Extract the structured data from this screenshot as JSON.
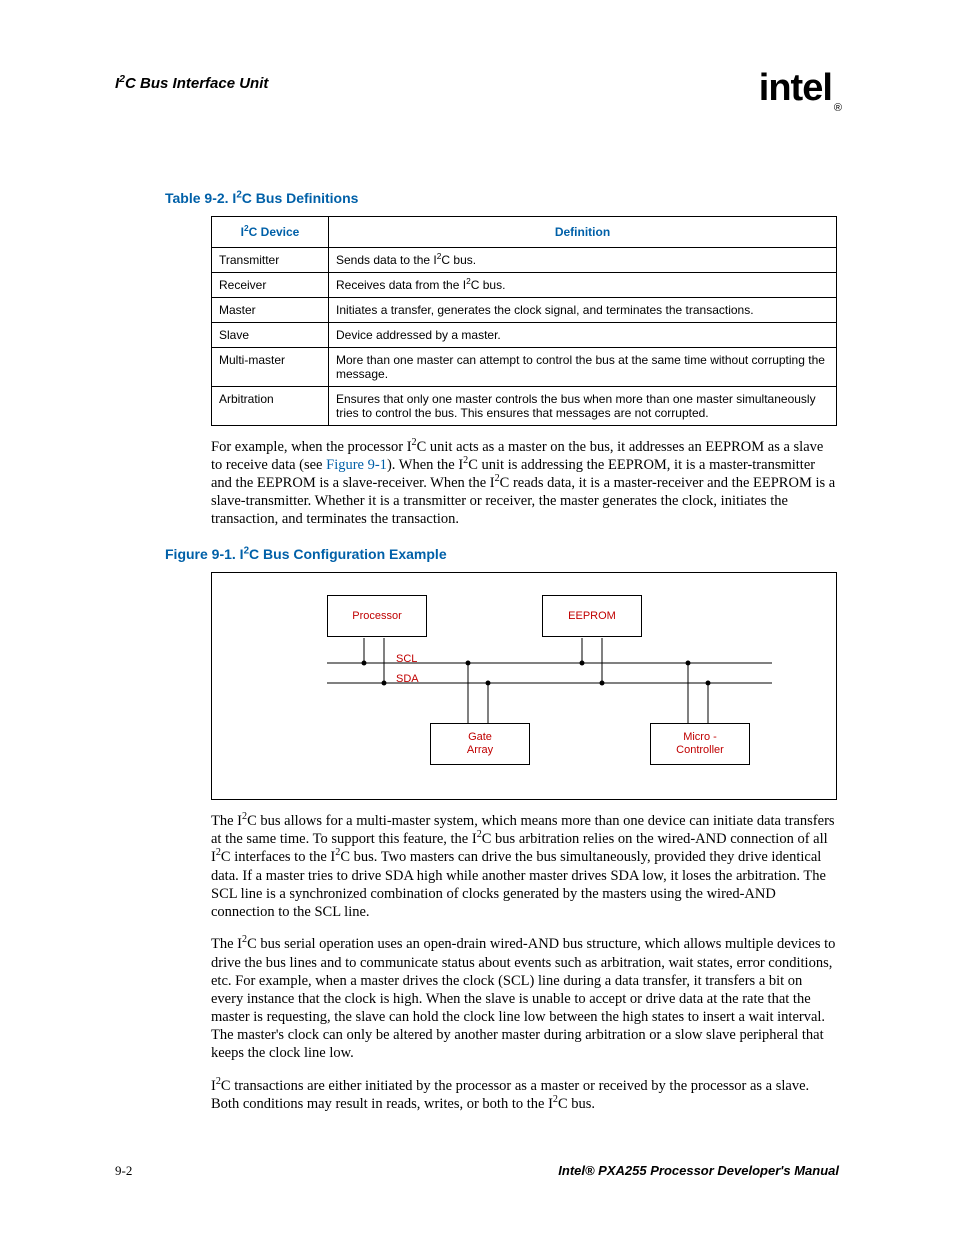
{
  "header": {
    "title_pre": "I",
    "title_sup": "2",
    "title_post": "C Bus Interface Unit",
    "logo": "intel",
    "logo_reg": "®"
  },
  "table_caption": {
    "pre": "Table 9-2.  I",
    "sup": "2",
    "post": "C Bus Definitions"
  },
  "table": {
    "h1_pre": "I",
    "h1_sup": "2",
    "h1_post": "C Device",
    "h2": "Definition",
    "rows": [
      {
        "d": "Transmitter",
        "def_pre": "Sends data to the I",
        "def_sup": "2",
        "def_post": "C bus."
      },
      {
        "d": "Receiver",
        "def_pre": "Receives data from the I",
        "def_sup": "2",
        "def_post": "C bus."
      },
      {
        "d": "Master",
        "def_pre": "Initiates a transfer, generates the clock signal, and terminates the transactions.",
        "def_sup": "",
        "def_post": ""
      },
      {
        "d": "Slave",
        "def_pre": "Device addressed by a master.",
        "def_sup": "",
        "def_post": ""
      },
      {
        "d": "Multi-master",
        "def_pre": "More than one master can attempt to control the bus at the same time without corrupting the message.",
        "def_sup": "",
        "def_post": ""
      },
      {
        "d": "Arbitration",
        "def_pre": "Ensures that only one master controls the bus when more than one master simultaneously tries to control the bus. This ensures that messages are not corrupted.",
        "def_sup": "",
        "def_post": ""
      }
    ]
  },
  "para1": {
    "s1a": "For example, when the processor I",
    "s1b": "C unit acts as a master on the bus, it addresses an EEPROM as a slave to receive data (see ",
    "link": "Figure 9-1",
    "s1c": "). When the I",
    "s1d": "C unit is addressing the EEPROM, it is a master-transmitter and the EEPROM is a slave-receiver. When the I",
    "s1e": "C reads data, it is a master-receiver and the EEPROM is a slave-transmitter. Whether it is a transmitter or receiver, the master generates the clock, initiates the transaction, and terminates the transaction."
  },
  "figure_caption": {
    "pre": "Figure 9-1.  I",
    "sup": "2",
    "post": "C Bus Configuration Example"
  },
  "figure": {
    "processor": "Processor",
    "eeprom": "EEPROM",
    "gate_array_1": "Gate",
    "gate_array_2": "Array",
    "micro_1": "Micro -",
    "micro_2": "Controller",
    "scl": "SCL",
    "sda": "SDA"
  },
  "para2": {
    "a": "The I",
    "b": "C bus allows for a multi-master system, which means more than one device can initiate data transfers at the same time. To support this feature, the I",
    "c": "C bus arbitration relies on the wired-AND connection of all I",
    "d": "C interfaces to the I",
    "e": "C bus. Two masters can drive the bus simultaneously, provided they drive identical data. If a master tries to drive SDA high while another master drives SDA low, it loses the arbitration. The SCL line is a synchronized combination of clocks generated by the masters using the wired-AND connection to the SCL line."
  },
  "para3": {
    "a": "The I",
    "b": "C bus serial operation uses an open-drain wired-AND bus structure, which allows multiple devices to drive the bus lines and to communicate status about events such as arbitration, wait states, error conditions, etc. For example, when a master drives the clock (SCL) line during a data transfer, it transfers a bit on every instance that the clock is high. When the slave is unable to accept or drive data at the rate that the master is requesting, the slave can hold the clock line low between the high states to insert a wait interval. The master's clock can only be altered by another master during arbitration or a slow slave peripheral that keeps the clock line low."
  },
  "para4": {
    "a": "I",
    "b": "C transactions are either initiated by the processor as a master or received by the processor as a slave. Both conditions may result in reads, writes, or both to the I",
    "c": "C bus."
  },
  "sup2": "2",
  "footer": {
    "page": "9-2",
    "title": "Intel® PXA255 Processor Developer's Manual"
  }
}
